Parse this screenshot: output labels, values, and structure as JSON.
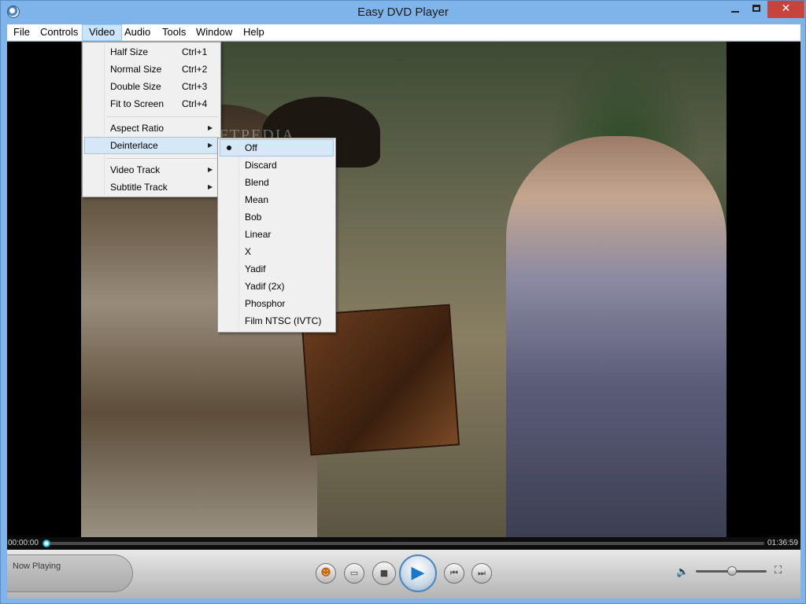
{
  "window": {
    "title": "Easy DVD Player",
    "close_glyph": "✕"
  },
  "menubar": {
    "items": [
      "File",
      "Controls",
      "Video",
      "Audio",
      "Tools",
      "Window",
      "Help"
    ],
    "active": "Video"
  },
  "video_menu": {
    "items": [
      {
        "label": "Half Size",
        "shortcut": "Ctrl+1"
      },
      {
        "label": "Normal Size",
        "shortcut": "Ctrl+2"
      },
      {
        "label": "Double Size",
        "shortcut": "Ctrl+3"
      },
      {
        "label": "Fit to Screen",
        "shortcut": "Ctrl+4"
      },
      {
        "label": "Aspect Ratio",
        "submenu": true
      },
      {
        "label": "Deinterlace",
        "submenu": true,
        "highlighted": true
      },
      {
        "label": "Video Track",
        "submenu": true
      },
      {
        "label": "Subtitle Track",
        "submenu": true
      }
    ]
  },
  "deinterlace_menu": {
    "items": [
      "Off",
      "Discard",
      "Blend",
      "Mean",
      "Bob",
      "Linear",
      "X",
      "Yadif",
      "Yadif (2x)",
      "Phosphor",
      "Film NTSC (IVTC)"
    ],
    "selected": "Off"
  },
  "watermark": "SOFTPEDIA",
  "seek": {
    "current": "00:00:00",
    "total": "01:36:59",
    "progress": 0.0
  },
  "controls": {
    "now_playing_label": "Now Playing",
    "volume": 0.5,
    "icons": [
      "people-icon",
      "folder-icon",
      "stop-icon",
      "play-icon",
      "previous-icon",
      "next-icon",
      "volume-icon",
      "fullscreen-icon"
    ]
  },
  "colors": {
    "titlebar": "#7eb4ea",
    "close_button": "#c7443b",
    "menu_highlight": "#d6e7f7",
    "play_accent": "#1877c8"
  }
}
